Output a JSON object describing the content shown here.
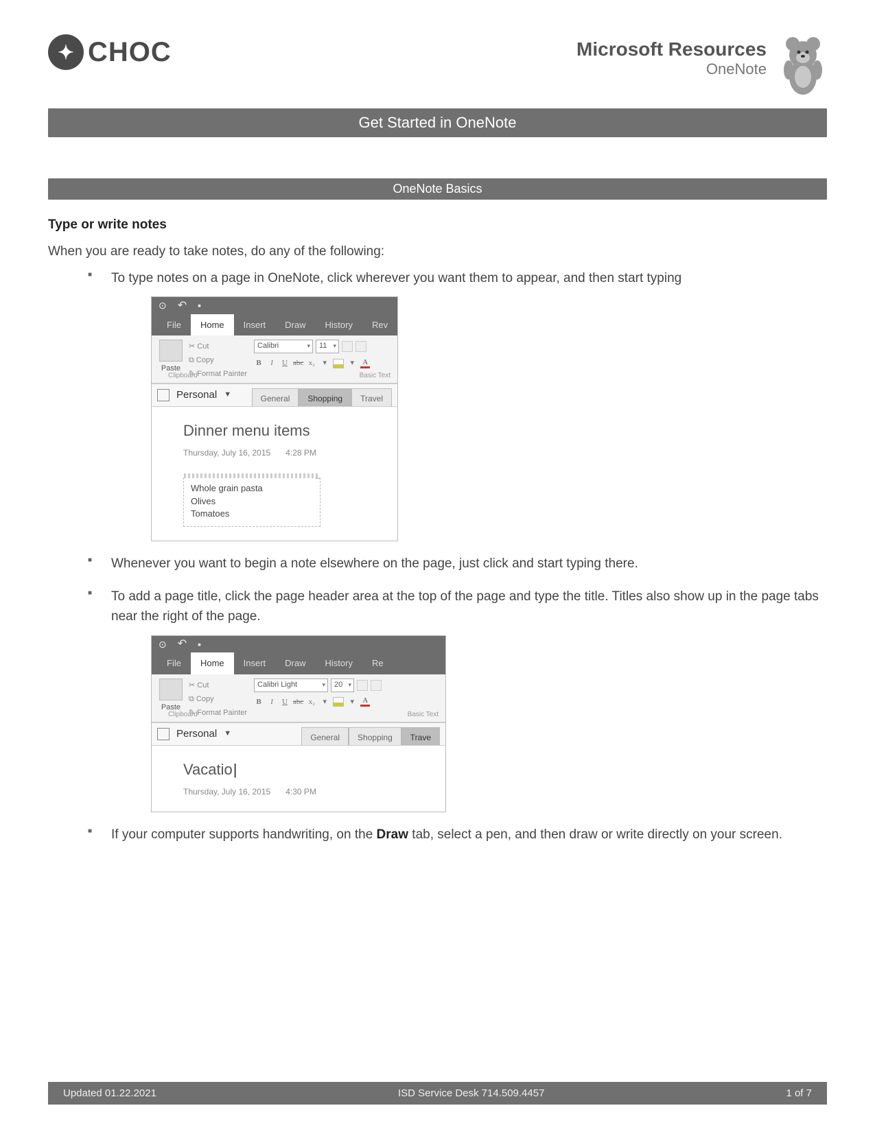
{
  "header": {
    "logo_text": "CHOC",
    "title": "Microsoft Resources",
    "subtitle": "OneNote"
  },
  "bars": {
    "main": "Get Started in OneNote",
    "sub": "OneNote Basics"
  },
  "body": {
    "heading": "Type or write notes",
    "intro": "When you are ready to take notes, do any of the following:",
    "bullets": {
      "b1": "To type notes on a page in OneNote, click wherever you want them to appear, and then start typing",
      "b2": "Whenever you want to begin a note elsewhere on the page, just click and start typing there.",
      "b3_a": "To add a page title, click the page header area at the top of the page and type the title. Titles also show up in the page tabs near the right of the page.",
      "b4_a": "If your computer supports handwriting, on the ",
      "b4_bold": "Draw",
      "b4_b": " tab, select a pen, and then draw or write directly on your screen."
    }
  },
  "win1": {
    "tabs": {
      "file": "File",
      "home": "Home",
      "insert": "Insert",
      "draw": "Draw",
      "history": "History",
      "rev": "Rev"
    },
    "clipboard": {
      "paste": "Paste",
      "cut": "Cut",
      "copy": "Copy",
      "format_painter": "Format Painter",
      "group": "Clipboard"
    },
    "font": {
      "name": "Calibri",
      "size": "11",
      "group": "Basic Text"
    },
    "notebook": {
      "name": "Personal",
      "sec_general": "General",
      "sec_shopping": "Shopping",
      "sec_travel": "Travel"
    },
    "page": {
      "title": "Dinner menu items",
      "date": "Thursday, July 16, 2015",
      "time": "4:28 PM",
      "line1": "Whole grain pasta",
      "line2": "Olives",
      "line3": "Tomatoes"
    }
  },
  "win2": {
    "tabs": {
      "file": "File",
      "home": "Home",
      "insert": "Insert",
      "draw": "Draw",
      "history": "History",
      "rev": "Re"
    },
    "clipboard": {
      "paste": "Paste",
      "cut": "Cut",
      "copy": "Copy",
      "format_painter": "Format Painter",
      "group": "Clipboard"
    },
    "font": {
      "name": "Calibri Light",
      "size": "20",
      "group": "Basic Text"
    },
    "notebook": {
      "name": "Personal",
      "sec_general": "General",
      "sec_shopping": "Shopping",
      "sec_travel": "Trave"
    },
    "page": {
      "title": "Vacatio",
      "date": "Thursday, July 16, 2015",
      "time": "4:30 PM"
    }
  },
  "footer": {
    "left": "Updated 01.22.2021",
    "center": "ISD Service Desk 714.509.4457",
    "right": "1 of 7"
  }
}
